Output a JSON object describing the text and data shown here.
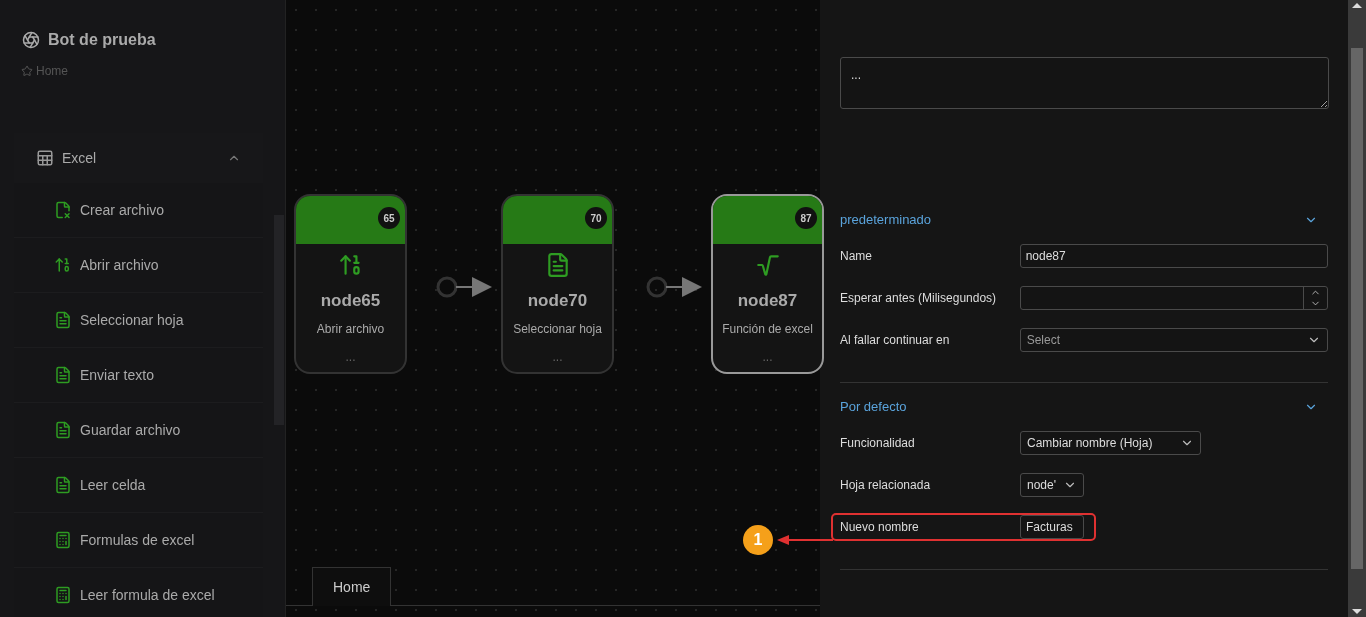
{
  "sidebar": {
    "title": "Bot de prueba",
    "breadcrumb": "Home",
    "group": {
      "label": "Excel",
      "expanded": true,
      "items": [
        {
          "label": "Crear archivo",
          "kind": "new"
        },
        {
          "label": "Abrir archivo",
          "kind": "open"
        },
        {
          "label": "Seleccionar hoja",
          "kind": "sheet"
        },
        {
          "label": "Enviar texto",
          "kind": "sheet"
        },
        {
          "label": "Guardar archivo",
          "kind": "sheet"
        },
        {
          "label": "Leer celda",
          "kind": "sheet"
        },
        {
          "label": "Formulas de excel",
          "kind": "formula"
        },
        {
          "label": "Leer formula de excel",
          "kind": "formula"
        }
      ]
    }
  },
  "canvas": {
    "nodes": [
      {
        "badge": "65",
        "name": "node65",
        "subtitle": "Abrir archivo",
        "note": "...",
        "kind": "open",
        "selected": false
      },
      {
        "badge": "70",
        "name": "node70",
        "subtitle": "Seleccionar hoja",
        "note": "...",
        "kind": "sheet",
        "selected": false
      },
      {
        "badge": "87",
        "name": "node87",
        "subtitle": "Función de excel",
        "note": "...",
        "kind": "function",
        "selected": true
      }
    ],
    "tabs": [
      {
        "label": "Home",
        "selected": true
      }
    ]
  },
  "panel": {
    "description": {
      "value": "..."
    },
    "sections": [
      {
        "title": "predeterminado",
        "expanded": true,
        "fields": [
          {
            "kind": "text",
            "label": "Name",
            "value": "node87"
          },
          {
            "kind": "number",
            "label": "Esperar antes (Milisegundos)"
          },
          {
            "kind": "select",
            "label": "Al fallar continuar en",
            "placeholder": "Select"
          }
        ]
      },
      {
        "title": "Por defecto",
        "expanded": true,
        "fields": [
          {
            "kind": "select",
            "label": "Funcionalidad",
            "value": "Cambiar nombre (Hoja)"
          },
          {
            "kind": "select",
            "label": "Hoja relacionada",
            "value": "node'"
          },
          {
            "kind": "text",
            "label": "Nuevo nombre",
            "value": "Facturas",
            "highlighted": true
          }
        ]
      }
    ]
  },
  "annotation": {
    "number": "1"
  }
}
